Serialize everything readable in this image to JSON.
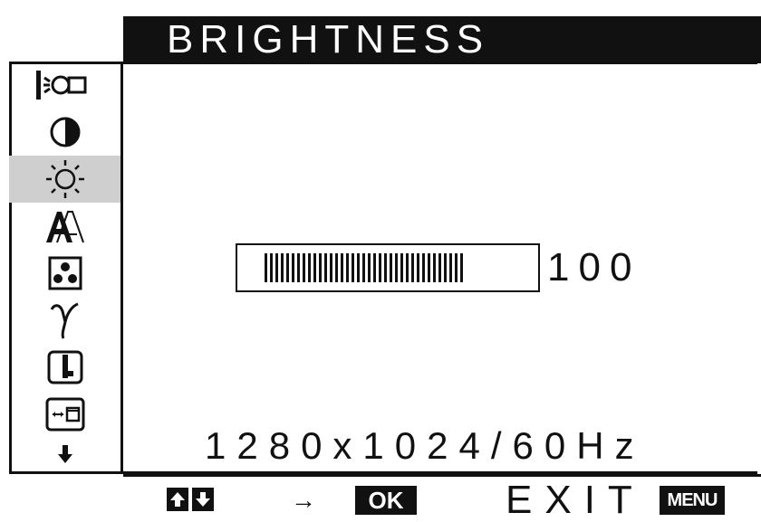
{
  "osd": {
    "title": "BRIGHTNESS",
    "selected_menu": "brightness",
    "menu_icons": [
      "backlight-icon",
      "contrast-icon",
      "brightness-icon",
      "sharpness-icon",
      "color-icon",
      "gamma-icon",
      "zoom-icon",
      "position-icon",
      "more-down-icon"
    ],
    "adjust": {
      "value": "100",
      "level": 0.82
    },
    "resolution": "1280x1024/60Hz"
  },
  "footer": {
    "select_symbols": "↑↓",
    "arrow": "→",
    "ok_label": "OK",
    "exit_label": "EXIT",
    "menu_key_label": "MENU"
  },
  "colors": {
    "foreground": "#111111",
    "background": "#ffffff",
    "selected_background": "#cfcfcf"
  }
}
